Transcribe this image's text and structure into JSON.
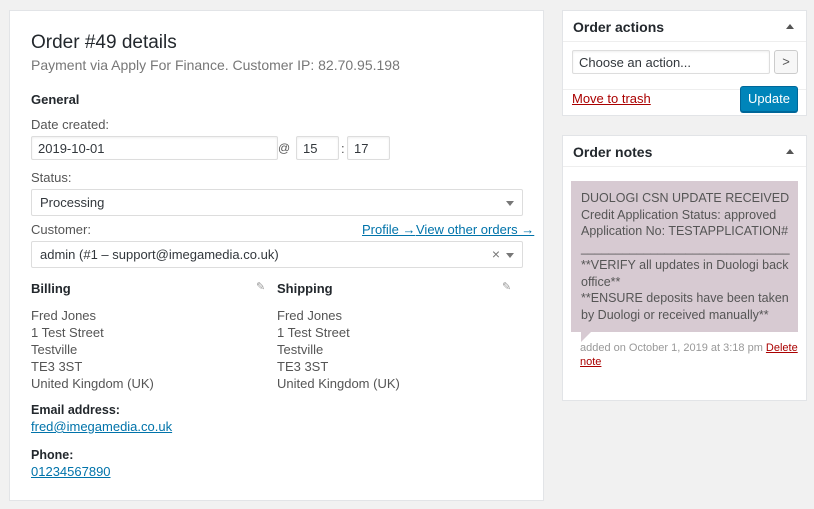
{
  "order": {
    "title": "Order #49 details",
    "subtitle": "Payment via Apply For Finance. Customer IP: 82.70.95.198"
  },
  "general": {
    "heading": "General",
    "date_label": "Date created:",
    "date_value": "2019-10-01",
    "at_symbol": "@",
    "hour": "15",
    "colon": ":",
    "minute": "17",
    "status_label": "Status:",
    "status_value": "Processing",
    "customer_label": "Customer:",
    "profile_link": "Profile →",
    "other_orders_link": "View other orders →",
    "customer_value": "admin (#1 – support@imegamedia.co.uk)",
    "clear_symbol": "×"
  },
  "billing": {
    "heading": "Billing",
    "address": [
      "Fred Jones",
      "1 Test Street",
      "Testville",
      "TE3 3ST",
      "United Kingdom (UK)"
    ],
    "email_label": "Email address:",
    "email": "fred@imegamedia.co.uk",
    "phone_label": "Phone:",
    "phone": "01234567890"
  },
  "shipping": {
    "heading": "Shipping",
    "address": [
      "Fred Jones",
      "1 Test Street",
      "Testville",
      "TE3 3ST",
      "United Kingdom (UK)"
    ]
  },
  "order_actions": {
    "heading": "Order actions",
    "select_value": "Choose an action...",
    "go_symbol": ">",
    "trash_label": "Move to trash",
    "update_label": "Update"
  },
  "order_notes": {
    "heading": "Order notes",
    "note_lines": [
      "DUOLOGI CSN UPDATE RECEIVED",
      "Credit Application Status: approved",
      "Application No: TESTAPPLICATION#",
      "______________________________",
      "**VERIFY all updates in Duologi back",
      "office**",
      "**ENSURE deposits have been taken",
      "by Duologi or received manually**"
    ],
    "meta_text": "added on October 1, 2019 at 3:18 pm",
    "delete_label": "Delete",
    "delete_label_2": "note"
  },
  "icons": {
    "edit": "pencil-icon",
    "collapse": "triangle-up-icon",
    "dropdown": "triangle-down-icon"
  }
}
